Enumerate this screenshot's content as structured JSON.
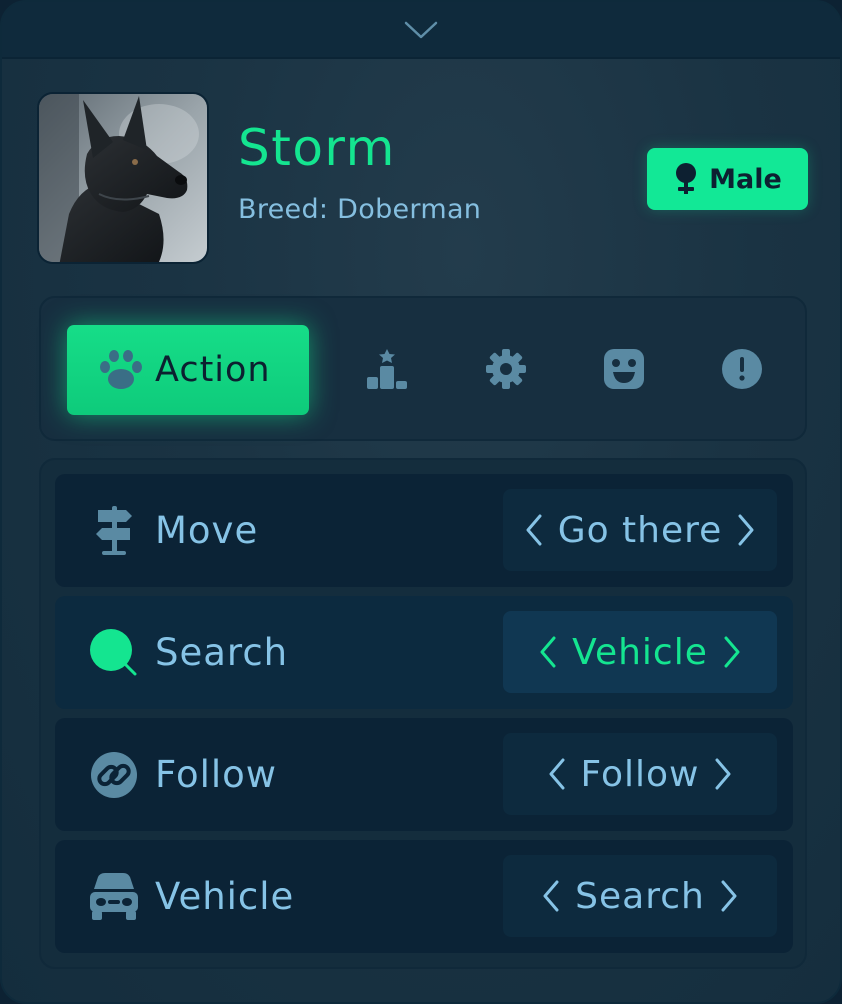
{
  "pet": {
    "name": "Storm",
    "breed": "Breed: Doberman",
    "gender": "Male",
    "avatar_icon": "doberman-photo"
  },
  "collapse_icon": "chevron-down-icon",
  "tabs": [
    {
      "id": "action",
      "label": "Action",
      "icon": "paw-icon",
      "active": true
    },
    {
      "id": "ranking",
      "icon": "podium-icon",
      "active": false
    },
    {
      "id": "settings",
      "icon": "gear-icon",
      "active": false
    },
    {
      "id": "mood",
      "icon": "smile-icon",
      "active": false
    },
    {
      "id": "alerts",
      "icon": "alert-icon",
      "active": false
    }
  ],
  "actions": [
    {
      "label": "Move",
      "icon": "signpost-icon",
      "value": "Go there",
      "selected": false
    },
    {
      "label": "Search",
      "icon": "search-icon",
      "value": "Vehicle",
      "selected": true
    },
    {
      "label": "Follow",
      "icon": "link-icon",
      "value": "Follow",
      "selected": false
    },
    {
      "label": "Vehicle",
      "icon": "car-icon",
      "value": "Search",
      "selected": false
    }
  ],
  "colors": {
    "accent": "#14e590",
    "text": "#86c3e6",
    "muted_icon": "#5a8aa3",
    "panel": "#1a3343",
    "row": "#0b2336"
  }
}
